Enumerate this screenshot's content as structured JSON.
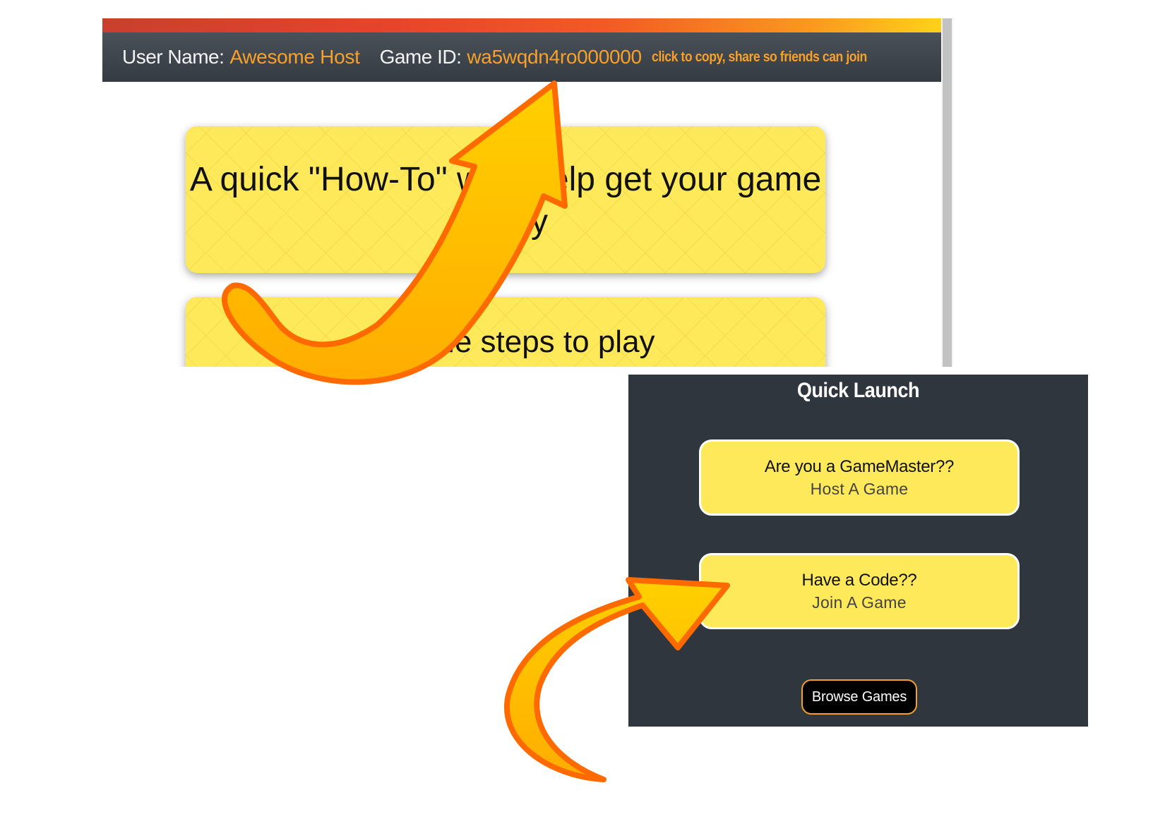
{
  "header": {
    "user_name_label": "User Name:",
    "user_name_value": "Awesome Host",
    "game_id_label": "Game ID:",
    "game_id_value": "wa5wqdn4ro000000",
    "copy_hint": "click to copy, share so friends can join"
  },
  "cards": {
    "how_to_title": "A quick \"How-To\" we'll help get your game ready",
    "steps_title": "3 simple steps to play"
  },
  "quick_launch": {
    "title": "Quick Launch",
    "host": {
      "line1": "Are you a GameMaster??",
      "line2": "Host A Game"
    },
    "join": {
      "line1": "Have a Code??",
      "line2": "Join A Game"
    },
    "browse_label": "Browse Games"
  },
  "colors": {
    "accent_orange": "#f7a12b",
    "card_yellow": "#fde95a",
    "header_dark": "#3b4149",
    "panel_dark": "#2f363e",
    "arrow_fill": "#ffc107",
    "arrow_outline": "#ff6a00"
  },
  "icons": {
    "arrow_top": "curved-arrow-icon",
    "arrow_bottom": "curved-arrow-icon"
  }
}
